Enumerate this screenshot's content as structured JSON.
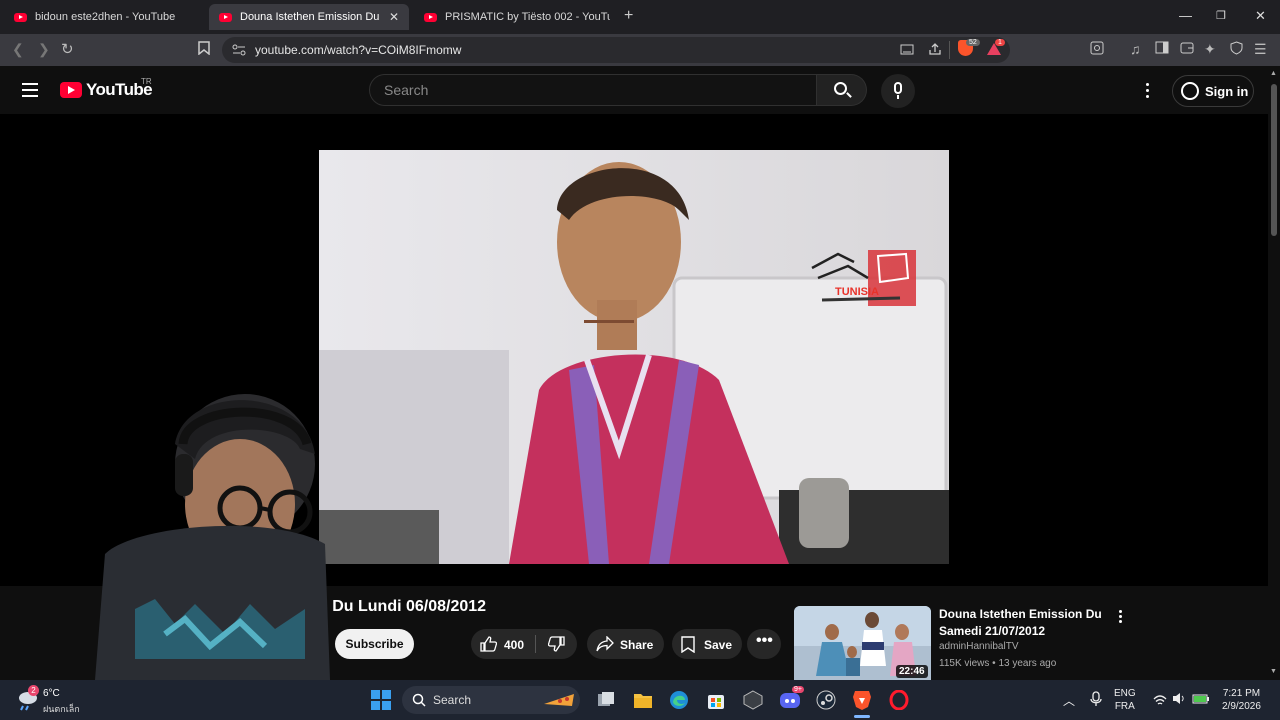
{
  "browser": {
    "tabs": [
      {
        "title": "bidoun este2dhen - YouTube",
        "active": false
      },
      {
        "title": "Douna Istethen Emission Du Lun",
        "active": true
      },
      {
        "title": "PRISMATIC by Tiësto 002 - YouTube",
        "active": false
      }
    ],
    "url": "youtube.com/watch?v=COiM8IFmomw",
    "shield_count": "52",
    "alert_count": "1"
  },
  "youtube": {
    "logo_text": "YouTube",
    "country_code": "TR",
    "search_placeholder": "Search",
    "sign_in_label": "Sign in"
  },
  "video": {
    "title_visible": "n Du Lundi 06/08/2012",
    "channel_overlay": "TUNISIA",
    "subscribe_label": "Subscribe",
    "likes": "400",
    "share_label": "Share",
    "save_label": "Save"
  },
  "related": {
    "title": "Douna Istethen Emission Du Samedi 21/07/2012",
    "channel": "adminHannibalTV",
    "meta": "115K views • 13 years ago",
    "duration": "22:46"
  },
  "taskbar": {
    "weather_temp": "6°C",
    "weather_desc": "ฝนตกเล็ก",
    "weather_badge": "2",
    "search_label": "Search",
    "discord_badge": "9+",
    "lang_top": "ENG",
    "lang_bottom": "FRA",
    "time": "7:21 PM",
    "date": "2/9/2026"
  },
  "colors": {
    "youtube_red": "#ff0033",
    "page_bg": "#0f0f0f",
    "taskbar_bg": "#1e2430"
  }
}
